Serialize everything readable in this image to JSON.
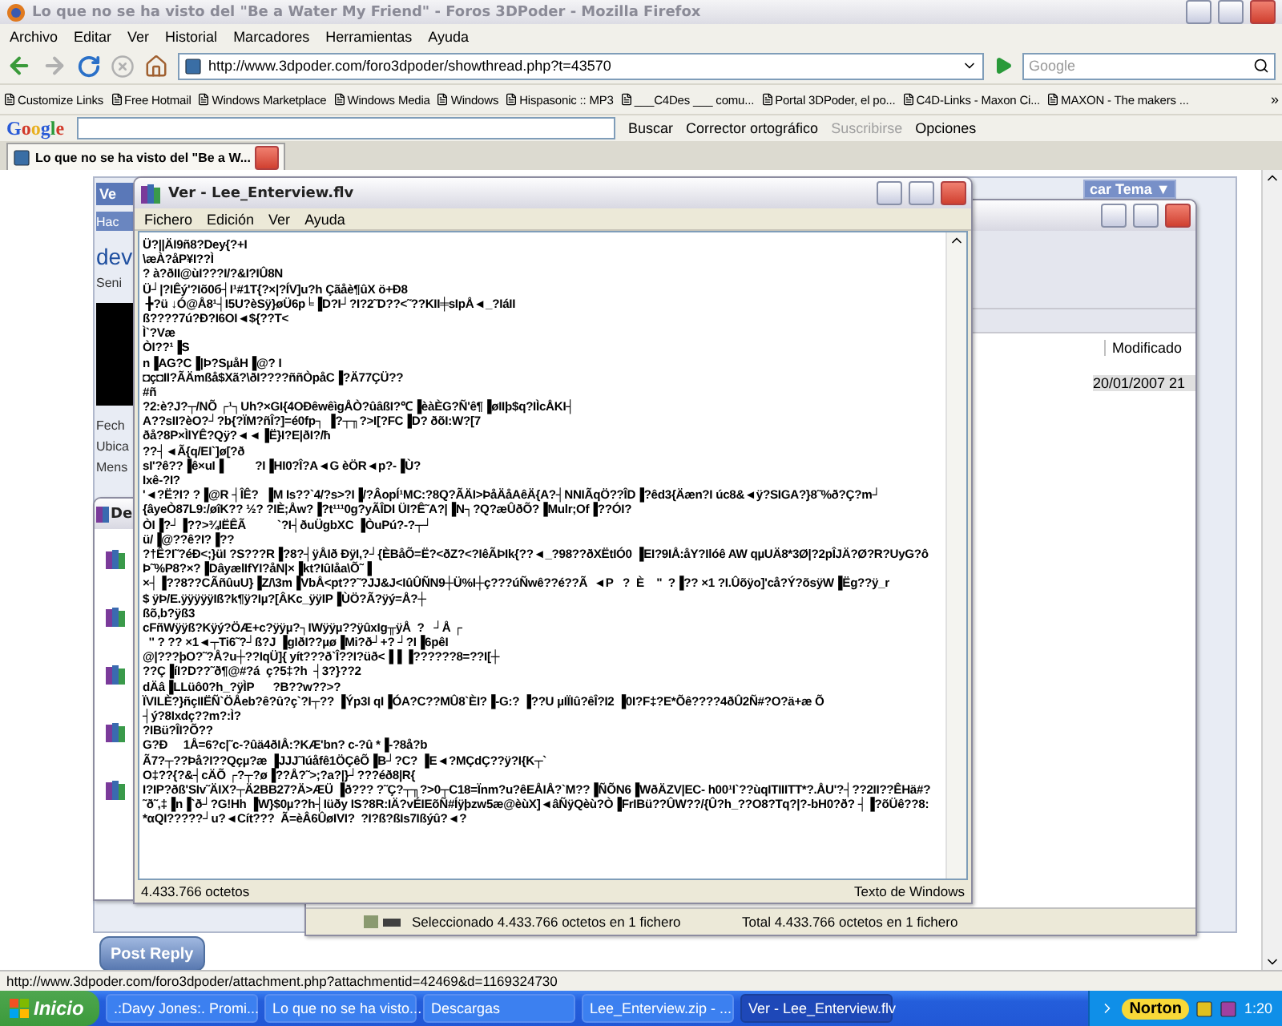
{
  "browser": {
    "title": "Lo que no se ha visto del \"Be a Water My Friend\" - Foros 3DPoder - Mozilla Firefox",
    "menu": [
      "Archivo",
      "Editar",
      "Ver",
      "Historial",
      "Marcadores",
      "Herramientas",
      "Ayuda"
    ],
    "address": "http://www.3dpoder.com/foro3dpoder/showthread.php?t=43570",
    "search": {
      "placeholder": "Google"
    },
    "bookmarks": [
      "Customize Links",
      "Free Hotmail",
      "Windows Marketplace",
      "Windows Media",
      "Windows",
      "Hispasonic :: MP3",
      "___C4Des ___ comu...",
      "Portal 3DPoder, el po...",
      "C4D-Links - Maxon Ci...",
      "MAXON - The makers ..."
    ],
    "bookmarks_overflow": "»",
    "google_toolbar": {
      "logo": "Google",
      "items": [
        {
          "label": "Buscar",
          "disabled": false
        },
        {
          "label": "Corrector ortográfico",
          "disabled": false
        },
        {
          "label": "Suscribirse",
          "disabled": true
        },
        {
          "label": "Opciones",
          "disabled": false
        }
      ]
    },
    "tabs": [
      {
        "label": "Lo que no se ha visto del \"Be a W...",
        "selected": true
      }
    ],
    "status_bar": "http://www.3dpoder.com/foro3dpoder/attachment.php?attachmentid=42469&d=1169324730"
  },
  "forum_page": {
    "header": "Ve",
    "subheader": "Hac",
    "user_link": "dev",
    "user_title": "Seni",
    "info_labels": [
      "Fech",
      "Ubica",
      "Mens"
    ],
    "thread_tools": "car Tema ▼",
    "post_reply": "Post Reply"
  },
  "downloads_window": {
    "title": "De"
  },
  "archive_window": {
    "column": "Modificado",
    "row_date": "20/01/2007 21",
    "status_selected": "Seleccionado 4.433.766 octetos en 1 fichero",
    "status_total": "Total 4.433.766 octetos en 1 fichero"
  },
  "viewer_window": {
    "title": "Ver - Lee_Enterview.flv",
    "menu": [
      "Fichero",
      "Edición",
      "Ver",
      "Ayuda"
    ],
    "lines": [
      "Ü?||ÄI9ñ8?Dey{?+I",
      "\\æÀ?åP¥I??Ì",
      "? à?ðII@ùI???I/?&I?IÛ8N",
      "Ü┘|?IÊý'?Iõ0б┤I¹#1T{?×|?ÍV]u?h Çãåè¶ûX ö+Ð8",
      " ╊?ü ↓Ó@Å8¹┤I5U?èSÿ}øÜ6p╘▐D?I┘?I?2˜D??<˜??KII╪sIpÅ◄_?IáII",
      "ß????7ú?Ð?I6OI◄${??T<",
      "Ì`?Væ",
      "ÒI??¹▐S",
      "n▐AG?C▐|Þ?SµåH▐@? I",
      "◘ç◘II?ÃÄmßå$Xã?\\ðI????ññÒpåC▐?Ä77ÇÜ??",
      "#ñ",
      "?2:è?J?┬/NÕ ┌¹┐Uh?×GI{4OÐêwêìgÅÒ?ûâßI?℃▐èàÈG?Ñ'ê¶▐øIIþ$q?IÌcÅKI┤",
      "A??sII?èO?┘?b{?ÏM?ñÎ?]=é0fp┐ ▐?┬╖?>I[?FC▐D? ðõI:W?[7",
      "ðå?8P×ÌlYÊ?Qÿ?◄◄▐Ë}I?E|ðI?/ħ",
      "??┤◄Ã{q/EI`]ø[?ð",
      "sI'?ê??▐ê×uI▐          ?I▐HI0?Î?A◄G èÖR◄p?-▐Ù?",
      "Ixê-?I?",
      "'◄?Ë?I? ?▐@R ┤ÎÊ?  ▐M Is??`4/?s>?I▐/?ÂopÍ¹MC:?8Q?ÃÄI>ÞåÄåAêÄ{A?┤NNIÃqÖ??ÎD▐?êd3{Äæn?I úc8&◄ÿ?SIGA?}8˜%ð?Ç?m┘",
      "{âyeÒ87L9:/øîK?? ½? ?IÈ;Åw?▐?t¹¹¹0g?yÃÎDI ÜI?Ê˜A?|▐N┐?Q?æÛðÕ?▐Mulr;Of▐??ÓI?",
      "ÒI▐?┘▐??>¾IËÊÃ          `?I┤ðuÜgbXC ▐ÒuPú?-?┬┘",
      "ü/▐@??ê?I?▐??",
      "?†Ê?I˜?éÐ<;}üI ?S???R▐?8?┤ÿÅIð ÐÿI,?┘{ÈBåÕ=Ë?<ðZ?<?IêÃÞIk{??◄_?98??ðXËtIÓ0 ▐EI?9IÅ:åY?Ilóê AW qµUÄ8*3Ø|?2pÎJÄ?Ø?R?UyG?ô",
      "Þ˜%P8?×?▐DâyælIfYI?åN|×▐kt?IûIåa\\Õ˜▐",
      "×┤▐??8??CÃñûuU}▐Z/\\3m▐VbÅ<pt??˜?JJ&J<IûÛÑN9┼Ü%I┼ç???úÑwê??é??Ã  ◄P   ?  È    ''  ?▐?? ×1 ?I.Ûõÿo]'cå?Ý?õsÿW▐Ëg??ÿ_r",
      "$ ÿÞ/E.ÿÿÿÿÿIß?k¶ÿ?Iµ?[ÂKc_ÿÿIP▐ÙÖ?Ã?ÿý=Å?┼",
      "ßõ,b?ÿß3",
      "cFñWÿÿß?Kÿý?ÖÆ+c?ÿÿµ?┐IWÿÿµ??ÿûxIg╥ÿÅ  ?   ┘Å ┌",
      "  '' ? ?? ×1◄┬Ti6˜?┘ß?J ▐gIðI??µø▐Mi?ð┘+? ┘?I▐6pêI",
      "@|???þO?˜?Å?u┼??IqÜ]{ yít???ð`Î??I?üð<▐▐ ▐??????8=??I[┼",
      "??Ç▐íI?D??˜ð¶@#?á  ç?5‡?h  ┤3?}??2",
      "dÄâ▐LLüô0?h_?ÿÌP      ?B??w??>?",
      "ÏVILÈ?}ñçIIËÑ`ÖÅeb?ê?û?ç`?I┬?? ▐Ýp3I qI▐ÓA?C??MÛ8`ÈI?▐-G:? ▐??U µIÏIû?êÎ?I2 ▐0I?F‡?E*Õê????4ðÛ2Ñ#?O?ä+æ Õ",
      "┤ý?8Ixdç??m?:Ì?",
      "?IBü?ÎI?Õ??",
      "G?Ð     1Å=6?c|˜c-?ûä4ðIÅ:?KÆ'bn? c-?û *▐-?8å?b",
      "Ã7?┬??Þå?I??Qçµ?æ ▐JJJ˜Iúåfê1ÖÇêÕ▐B┘?C? ▐E◄?MÇdÇ??ÿ?I{K┬`",
      "O‡??{?&┤cÄÕ ┌?┬?ø▐??Å?˜>;?a?|}┘???éð8|R{",
      "I?IP?ðß'SIv˜ÄIX?┬Ä2BB27?Ä>ÆÜ ▐ð??? ?˜Ç?┬╖?>0┬C18=Ïnm?u?êEÅIÅ?`M??▐ÑÕN6▐WðÄZV|EC- h00¹I`??ùqITIIITT*?.ÅU'?┤??2II??ÊHä#?",
      "˜ð˜,‡▐n▐`ð┘?G!Hh ▐W}$0µ??h┤Iüðy IS?8R:IÄ?vÉIEõÑ#Íÿþzw5æ@èùX]◄âÑÿQèù?Ò▐FrIBü??ÛW??/{Û?h_??O8?Tq?|?-bH0?ð? ┤▐?õÜê??8:",
      "*αQI?????┘u?◄Cít???  Ã=èÂ6ÛøIVI?  ?I?ß?ßIs7Ißýû?◄?"
    ],
    "status_size": "4.433.766 octetos",
    "status_encoding": "Texto de Windows"
  },
  "taskbar": {
    "start": "Inicio",
    "tasks": [
      {
        "label": ".:Davy Jones:. Promi...",
        "selected": false
      },
      {
        "label": "Lo que no se ha visto...",
        "selected": false
      },
      {
        "label": "Descargas",
        "selected": false
      },
      {
        "label": "Lee_Enterview.zip - ...",
        "selected": false
      },
      {
        "label": "Ver - Lee_Enterview.flv",
        "selected": true
      }
    ],
    "tray_brand": "Norton",
    "clock": "1:20"
  }
}
